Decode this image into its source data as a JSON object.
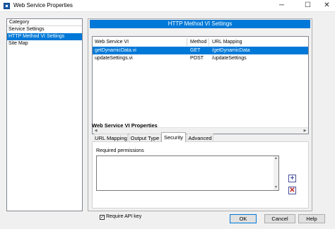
{
  "window": {
    "title": "Web Service Properties",
    "controls": {
      "minimize": "─",
      "maximize": "☐",
      "close": "✕"
    }
  },
  "sidebar": {
    "header": "Category",
    "items": [
      {
        "label": "Service Settings",
        "selected": false
      },
      {
        "label": "HTTP Method VI Settings",
        "selected": true
      },
      {
        "label": "Site Map",
        "selected": false
      }
    ]
  },
  "main": {
    "section_title": "HTTP Method VI Settings",
    "table": {
      "columns": [
        "Web Service VI",
        "Method",
        "URL Mapping"
      ],
      "rows": [
        {
          "vi": "getDynamicData.vi",
          "method": "GET",
          "url": "/getDynamicData",
          "selected": true
        },
        {
          "vi": "updateSettings.vi",
          "method": "POST",
          "url": "/updateSettings",
          "selected": false
        }
      ]
    },
    "properties_title": "Web Service VI Properties",
    "tabs": [
      {
        "label": "URL Mapping",
        "active": false
      },
      {
        "label": "Output Type",
        "active": false
      },
      {
        "label": "Security",
        "active": true
      },
      {
        "label": "Advanced",
        "active": false
      }
    ],
    "security": {
      "required_permissions_label": "Required permissions",
      "add_glyph": "+",
      "remove_glyph": "✕",
      "require_api_key_label": "Require API key",
      "require_api_key_checked": true,
      "check_glyph": "✓"
    }
  },
  "buttons": {
    "ok": "OK",
    "cancel": "Cancel",
    "help": "Help"
  },
  "colors": {
    "selection": "#0078d7",
    "add_icon": "#4648a4",
    "remove_icon": "#c02020"
  }
}
